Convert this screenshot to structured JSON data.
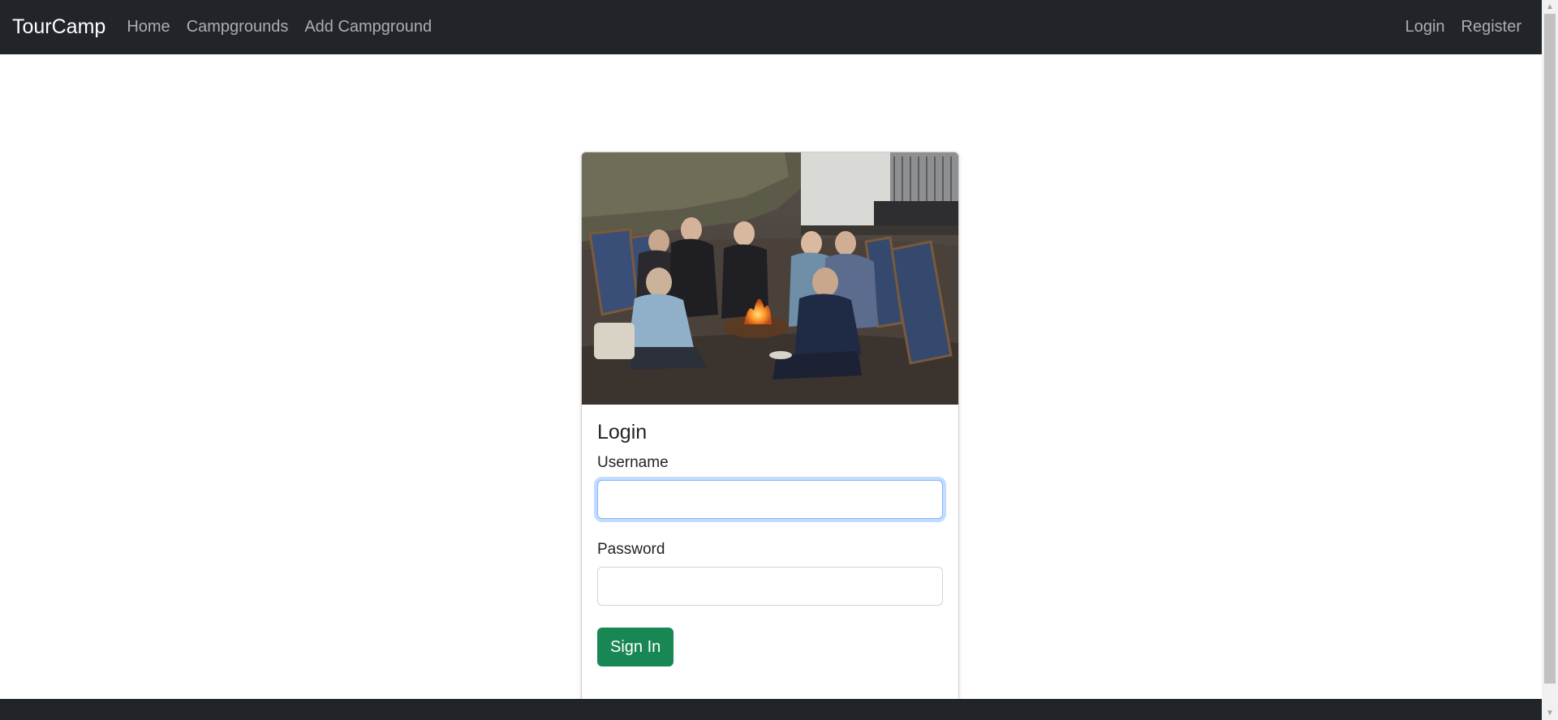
{
  "navbar": {
    "brand": "TourCamp",
    "left_links": [
      {
        "label": "Home"
      },
      {
        "label": "Campgrounds"
      },
      {
        "label": "Add Campground"
      }
    ],
    "right_links": [
      {
        "label": "Login"
      },
      {
        "label": "Register"
      }
    ],
    "background_color": "#212529"
  },
  "card": {
    "image_icon": "campfire-photo",
    "title": "Login",
    "username_label": "Username",
    "username_value": "",
    "password_label": "Password",
    "password_value": "",
    "submit_label": "Sign In",
    "submit_color": "#198754"
  },
  "footer": {
    "background_color": "#212529"
  }
}
